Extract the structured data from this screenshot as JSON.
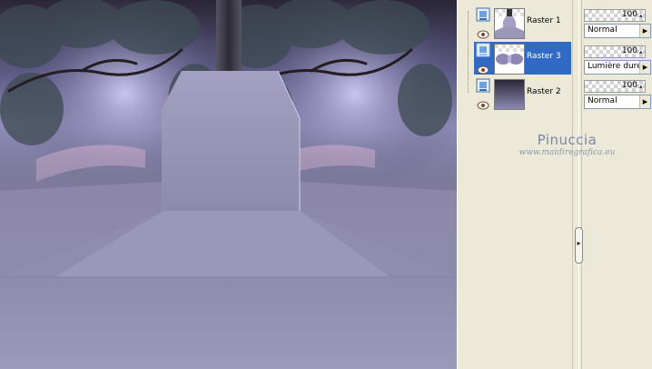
{
  "canvas": {
    "icon": "image-canvas"
  },
  "layers": [
    {
      "name": "Raster 1",
      "opacity": "100",
      "blend_mode": "Normal",
      "selected": false,
      "thumbnail": "mirror-light-shape"
    },
    {
      "name": "Raster 3",
      "opacity": "100",
      "blend_mode": "Lumière dure",
      "selected": true,
      "thumbnail": "trees-transparent"
    },
    {
      "name": "Raster 2",
      "opacity": "100",
      "blend_mode": "Normal",
      "selected": false,
      "thumbnail": "purple-gradient"
    }
  ],
  "watermark": {
    "name": "Pinuccia",
    "url": "www.maidiregrafica.eu"
  },
  "icons": {
    "visibility": "eye-icon",
    "layer_type": "raster-layer-icon",
    "dropdown": "triangle-right-icon",
    "collapse": "chevron-dots-icon"
  },
  "colors": {
    "selection": "#316ac5",
    "panel": "#ece9d8",
    "scene_purple": "#8e8aab"
  }
}
